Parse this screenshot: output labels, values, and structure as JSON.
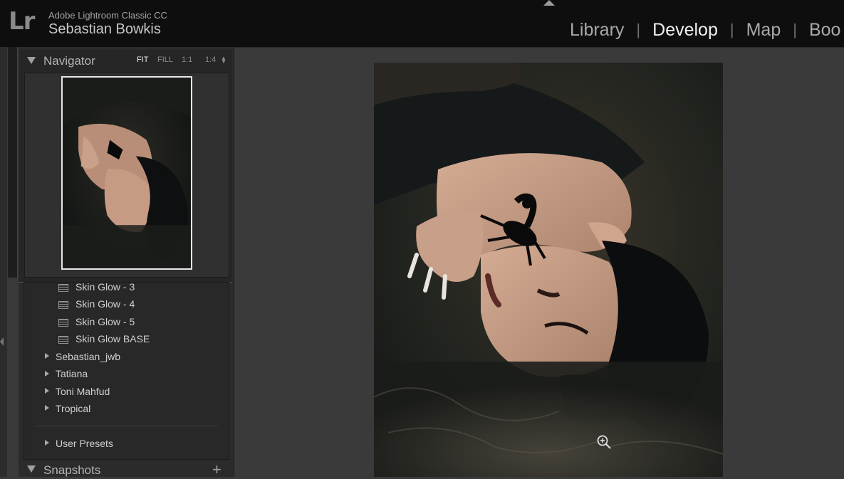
{
  "header": {
    "logo_text": "Lr",
    "app_name": "Adobe Lightroom Classic CC",
    "user_name": "Sebastian Bowkis",
    "modules": [
      {
        "label": "Library",
        "active": false
      },
      {
        "label": "Develop",
        "active": true
      },
      {
        "label": "Map",
        "active": false
      },
      {
        "label": "Boo",
        "active": false
      }
    ],
    "separator": "|"
  },
  "navigator": {
    "title": "Navigator",
    "zoom_options": [
      "FIT",
      "FILL",
      "1:1",
      "1:4"
    ],
    "active_zoom": "FIT"
  },
  "presets": {
    "items": [
      "Skin Glow - 3",
      "Skin Glow - 4",
      "Skin Glow - 5",
      "Skin Glow BASE"
    ],
    "folders": [
      "Sebastian_jwb",
      "Tatiana",
      "Toni Mahfud",
      "Tropical"
    ],
    "user_presets": "User Presets"
  },
  "snapshots": {
    "title": "Snapshots",
    "add_icon": "plus-icon"
  },
  "colors": {
    "topbar_bg": "#0e0e0e",
    "panel_bg": "#2b2b2b",
    "canvas_bg": "#3a3a3a",
    "active_module": "#f0f0f0",
    "inactive_module": "#a9a9a9"
  }
}
